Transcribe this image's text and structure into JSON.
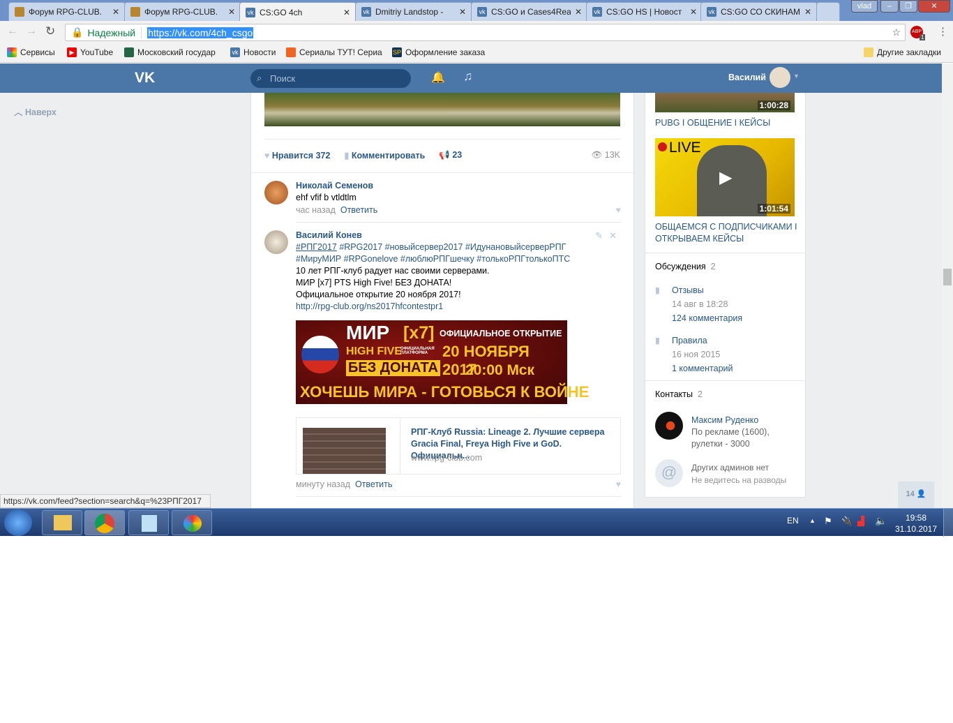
{
  "browser": {
    "tabs": [
      {
        "title": "Форум RPG-CLUB.",
        "icon": "rpg"
      },
      {
        "title": "Форум RPG-CLUB.",
        "icon": "rpg"
      },
      {
        "title": "CS:GO 4ch",
        "icon": "vk",
        "active": true
      },
      {
        "title": "Dmitriy Landstop -",
        "icon": "vk"
      },
      {
        "title": "CS:GO и Cases4Rea",
        "icon": "vk"
      },
      {
        "title": "CS:GO HS | Новост",
        "icon": "vk"
      },
      {
        "title": "CS:GO СО СКИНАМ",
        "icon": "vk"
      }
    ],
    "user": "vlad",
    "secure_label": "Надежный",
    "url": "https://vk.com/4ch_csgo",
    "ext_badge": "1",
    "bookmarks": [
      "Сервисы",
      "YouTube",
      "Московский государ",
      "Новости",
      "Сериалы ТУТ! Сериа",
      "Оформление заказа"
    ],
    "other_bookmarks": "Другие закладки",
    "status_url": "https://vk.com/feed?section=search&q=%23РПГ2017"
  },
  "vk": {
    "search_placeholder": "Поиск",
    "user_name": "Василий",
    "back_to_top": "Наверх"
  },
  "post_actions": {
    "like_label": "Нравится",
    "likes": "372",
    "comment_label": "Комментировать",
    "shares": "23",
    "views": "13K"
  },
  "comments": [
    {
      "author": "Николай Семенов",
      "text": "ehf vfif b vtldtlm",
      "time": "час назад",
      "reply": "Ответить"
    },
    {
      "author": "Василий Конев",
      "hashtags1": "#РПГ2017",
      "hashtags1b": " #RPG2017 #новыйсервер2017 #ИдунановыйсерверРПГ",
      "hashtags2": "#МируМИР #RPGonelove #люблюРПГшечку #толькоРПГтолькоПТС",
      "lines": [
        "10 лет РПГ-клуб радует нас своими серверами.",
        "МИР [x7] PTS High Five! БЕЗ ДОНАТА!",
        "Официальное открытие 20 ноября 2017!"
      ],
      "link": "http://rpg-club.org/ns2017hfcontestpr1",
      "time": "минуту назад",
      "reply": "Ответить"
    }
  ],
  "banner": {
    "l1": "МИР",
    "l1b": "[x7]",
    "l2": "HIGH FIVE",
    "l2b": "ОФИЦИАЛЬНАЯ ПЛАТФОРМА",
    "l3": "БЕЗ ДОНАТА",
    "r1": "ОФИЦИАЛЬНОЕ ОТКРЫТИЕ",
    "r2": "20 НОЯБРЯ 2017",
    "r3": "20:00 Мск",
    "bottom": "ХОЧЕШЬ МИРА - ГОТОВЬСЯ К ВОЙНЕ"
  },
  "link_card": {
    "title": "РПГ-Клуб Russia: Lineage 2. Лучшие сервера Gracia Final, Freya High Five и GoD. Официальн...",
    "domain": "www.rpg-club.com"
  },
  "sidebar": {
    "videos": [
      {
        "duration": "1:00:28",
        "title": "PUBG I ОБЩЕНИЕ I КЕЙСЫ"
      },
      {
        "live": "LIVE",
        "duration": "1:01:54",
        "title": "ОБЩАЕМСЯ С ПОДПИСЧИКАМИ I ОТКРЫВАЕМ КЕЙСЫ"
      }
    ],
    "discussions": {
      "title": "Обсуждения",
      "count": "2",
      "items": [
        {
          "title": "Отзывы",
          "date": "14 авг в 18:28",
          "comments": "124 комментария"
        },
        {
          "title": "Правила",
          "date": "16 ноя 2015",
          "comments": "1 комментарий"
        }
      ]
    },
    "contacts": {
      "title": "Контакты",
      "count": "2",
      "items": [
        {
          "name": "Максим Руденко",
          "desc": "По рекламе (1600), рулетки - 3000"
        },
        {
          "name": "Других админов нет",
          "desc": "Не ведитесь на разводы"
        }
      ]
    },
    "online_count": "14"
  },
  "taskbar": {
    "lang": "EN",
    "time": "19:58",
    "date": "31.10.2017"
  }
}
